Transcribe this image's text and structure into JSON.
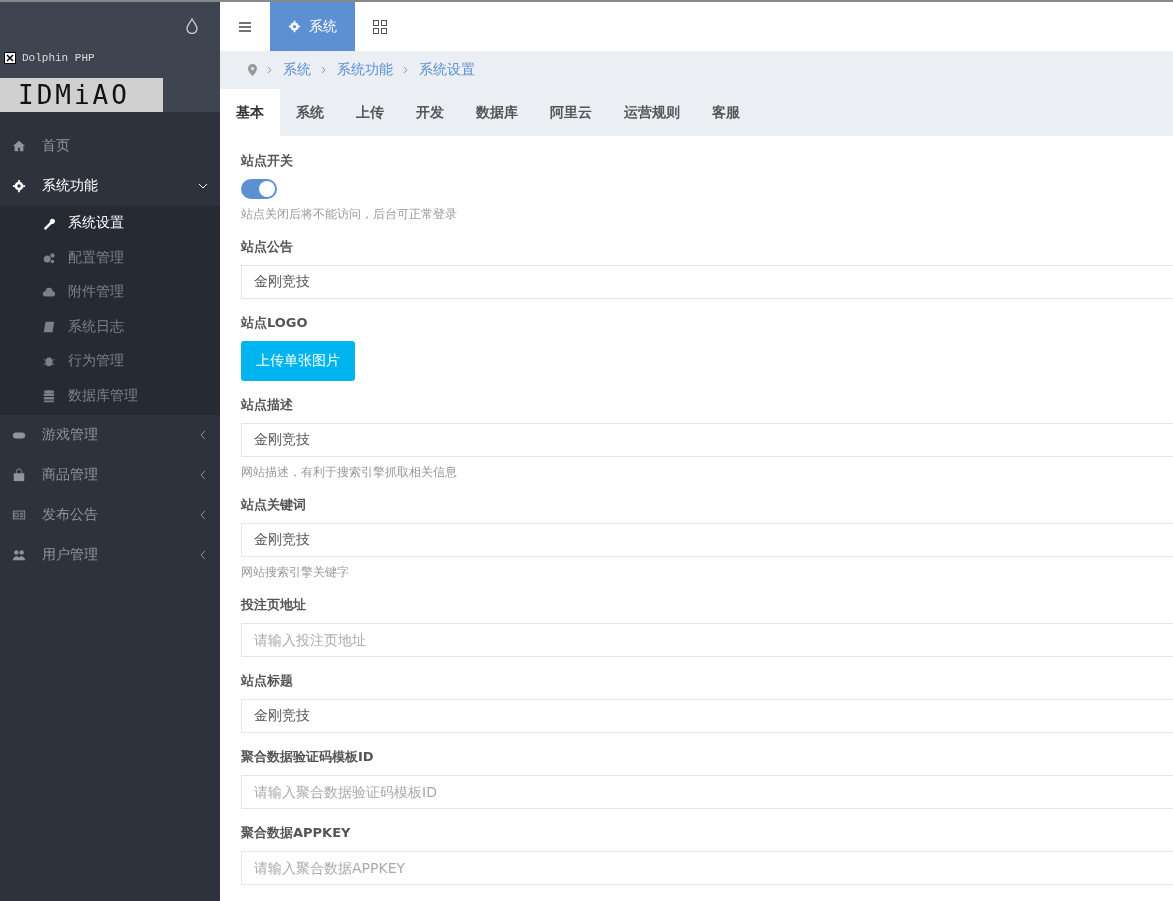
{
  "sidebar": {
    "brand_alt": "Dolphin PHP",
    "logo": "IDMiAO",
    "menu": [
      {
        "label": "首页",
        "selected": false
      },
      {
        "label": "系统功能",
        "expanded": true,
        "selected": true,
        "children": [
          {
            "label": "系统设置",
            "selected": true
          },
          {
            "label": "配置管理",
            "selected": false
          },
          {
            "label": "附件管理",
            "selected": false
          },
          {
            "label": "系统日志",
            "selected": false
          },
          {
            "label": "行为管理",
            "selected": false
          },
          {
            "label": "数据库管理",
            "selected": false
          }
        ]
      },
      {
        "label": "游戏管理",
        "expanded": false,
        "selected": false
      },
      {
        "label": "商品管理",
        "expanded": false,
        "selected": false
      },
      {
        "label": "发布公告",
        "expanded": false,
        "selected": false
      },
      {
        "label": "用户管理",
        "expanded": false,
        "selected": false
      }
    ]
  },
  "top_tabs": [
    {
      "label": "系统",
      "selected": true
    }
  ],
  "breadcrumb": [
    "系统",
    "系统功能",
    "系统设置"
  ],
  "tabs": [
    {
      "label": "基本",
      "selected": true
    },
    {
      "label": "系统",
      "selected": false
    },
    {
      "label": "上传",
      "selected": false
    },
    {
      "label": "开发",
      "selected": false
    },
    {
      "label": "数据库",
      "selected": false
    },
    {
      "label": "阿里云",
      "selected": false
    },
    {
      "label": "运营规则",
      "selected": false
    },
    {
      "label": "客服",
      "selected": false
    }
  ],
  "fields": [
    {
      "kind": "toggle",
      "label": "站点开关",
      "on": true,
      "help": "站点关闭后将不能访问，后台可正常登录"
    },
    {
      "kind": "text",
      "label": "站点公告",
      "value": "金刚竞技"
    },
    {
      "kind": "upload",
      "label": "站点LOGO",
      "button": "上传单张图片"
    },
    {
      "kind": "text",
      "label": "站点描述",
      "value": "金刚竞技",
      "help": "网站描述，有利于搜索引擎抓取相关信息"
    },
    {
      "kind": "text",
      "label": "站点关键词",
      "value": "金刚竞技",
      "help": "网站搜索引擎关键字"
    },
    {
      "kind": "text",
      "label": "投注页地址",
      "placeholder": "请输入投注页地址"
    },
    {
      "kind": "text",
      "label": "站点标题",
      "value": "金刚竞技"
    },
    {
      "kind": "text",
      "label": "聚合数据验证码模板ID",
      "placeholder": "请输入聚合数据验证码模板ID"
    },
    {
      "kind": "text",
      "label": "聚合数据APPKEY",
      "placeholder": "请输入聚合数据APPKEY"
    }
  ]
}
